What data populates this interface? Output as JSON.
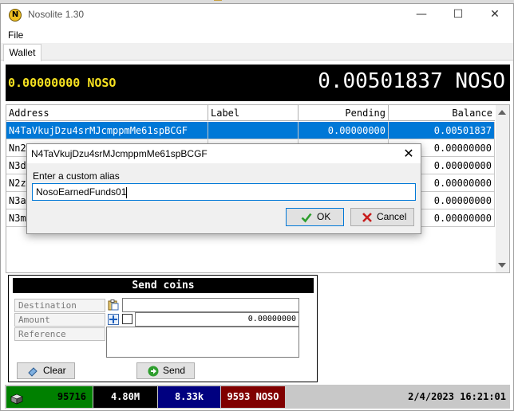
{
  "window": {
    "title": "Nosolite 1.30",
    "minimize_glyph": "—",
    "maximize_glyph": "☐",
    "close_glyph": "✕"
  },
  "menu": {
    "file": "File"
  },
  "tabs": [
    {
      "label": "Wallet"
    }
  ],
  "balance": {
    "left": "0.00000000 NOSO",
    "right": "0.00501837 NOSO"
  },
  "address_grid": {
    "columns": {
      "address": "Address",
      "label": "Label",
      "pending": "Pending",
      "balance": "Balance"
    },
    "rows": [
      {
        "address": "N4TaVkujDzu4srMJcmppmMe61spBCGF",
        "label": "",
        "pending": "0.00000000",
        "balance": "0.00501837",
        "selected": true
      },
      {
        "address": "Nn2",
        "label": "",
        "pending": "",
        "balance": "0.00000000",
        "selected": false
      },
      {
        "address": "N3d",
        "label": "",
        "pending": "",
        "balance": "0.00000000",
        "selected": false
      },
      {
        "address": "N2z",
        "label": "",
        "pending": "",
        "balance": "0.00000000",
        "selected": false
      },
      {
        "address": "N3a",
        "label": "",
        "pending": "",
        "balance": "0.00000000",
        "selected": false
      },
      {
        "address": "N3m",
        "label": "",
        "pending": "",
        "balance": "0.00000000",
        "selected": false
      }
    ]
  },
  "send_coins": {
    "header": "Send coins",
    "destination_label": "Destination",
    "amount_label": "Amount",
    "reference_label": "Reference",
    "amount_value": "0.00000000",
    "clear_label": "Clear",
    "send_label": "Send",
    "icons": {
      "paste": "paste-icon",
      "add": "plus-icon",
      "clear": "eraser-icon",
      "send": "arrow-right-icon"
    }
  },
  "status": {
    "block": "95716",
    "stat2": "4.80M",
    "stat3": "8.33k",
    "stat4": "9593 NOSO",
    "datetime": "2/4/2023 16:21:01",
    "colors": {
      "block_bg": "#008000",
      "block_fg": "#000000",
      "stat2_bg": "#000000",
      "stat3_bg": "#000080",
      "stat4_bg": "#800000"
    }
  },
  "alias_dialog": {
    "title": "N4TaVkujDzu4srMJcmppmMe61spBCGF",
    "prompt": "Enter a custom alias",
    "value": "NosoEarnedFunds01",
    "ok_label": "OK",
    "cancel_label": "Cancel",
    "close_glyph": "✕"
  },
  "colors": {
    "selection": "#0078d7",
    "balance_left": "#f5e020",
    "balance_right": "#ffffff",
    "ok_check": "#2e9e2e",
    "cancel_x": "#c81e1e"
  }
}
